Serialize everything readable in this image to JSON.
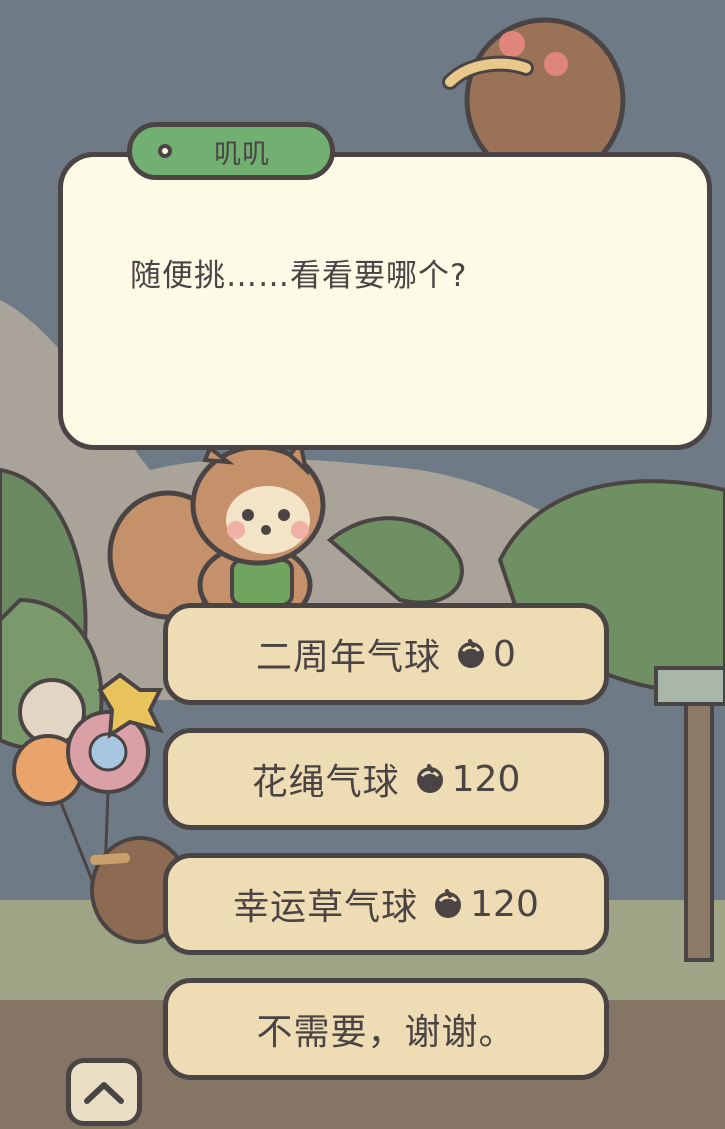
{
  "dialog": {
    "speaker": "叽叽",
    "text": "随便挑……看看要哪个?"
  },
  "choices": [
    {
      "label": "二周年气球",
      "cost": "0"
    },
    {
      "label": "花绳气球",
      "cost": "120"
    },
    {
      "label": "幸运草气球",
      "cost": "120"
    },
    {
      "label": "不需要，谢谢。"
    }
  ],
  "icons": {
    "currency": "acorn-icon",
    "collapse": "chevron-up-icon"
  },
  "colors": {
    "dialog_bg": "#fdfbe6",
    "speaker_tag": "#72b072",
    "choice_bg": "#eedcb4",
    "outline": "#4b4444"
  }
}
